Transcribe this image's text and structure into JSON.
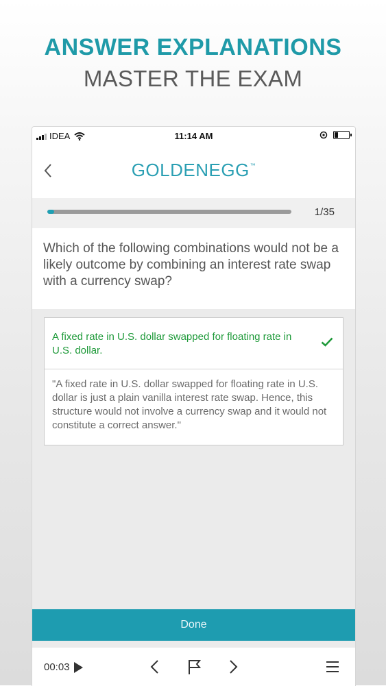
{
  "promo": {
    "headline": "ANSWER EXPLANATIONS",
    "subheadline": "MASTER THE EXAM"
  },
  "status_bar": {
    "carrier": "IDEA",
    "time": "11:14 AM"
  },
  "header": {
    "logo_text": "GOLDENEGG",
    "logo_tm": "™"
  },
  "progress": {
    "label": "1/35",
    "fraction": 0.0286
  },
  "question": {
    "text": "Which of the following combinations would not be a likely outcome by combining an interest rate swap with a currency swap?"
  },
  "answer": {
    "text": "A fixed rate in U.S. dollar swapped for floating rate in U.S. dollar.",
    "correct": true,
    "explanation": "\"A fixed rate in U.S. dollar swapped for floating rate in U.S. dollar is just a plain vanilla interest rate swap. Hence, this structure would not involve a currency swap and it would not constitute a correct answer.\""
  },
  "actions": {
    "done_label": "Done"
  },
  "bottom_bar": {
    "timer": "00:03"
  },
  "colors": {
    "accent": "#1e9cb0",
    "correct": "#1f9a3a",
    "headline": "#1f9aa8"
  },
  "icons": {
    "back": "chevron-left-icon",
    "check": "checkmark-icon",
    "play": "play-icon",
    "prev": "chevron-left-icon",
    "flag": "flag-icon",
    "next": "chevron-right-icon",
    "menu": "hamburger-menu-icon"
  }
}
